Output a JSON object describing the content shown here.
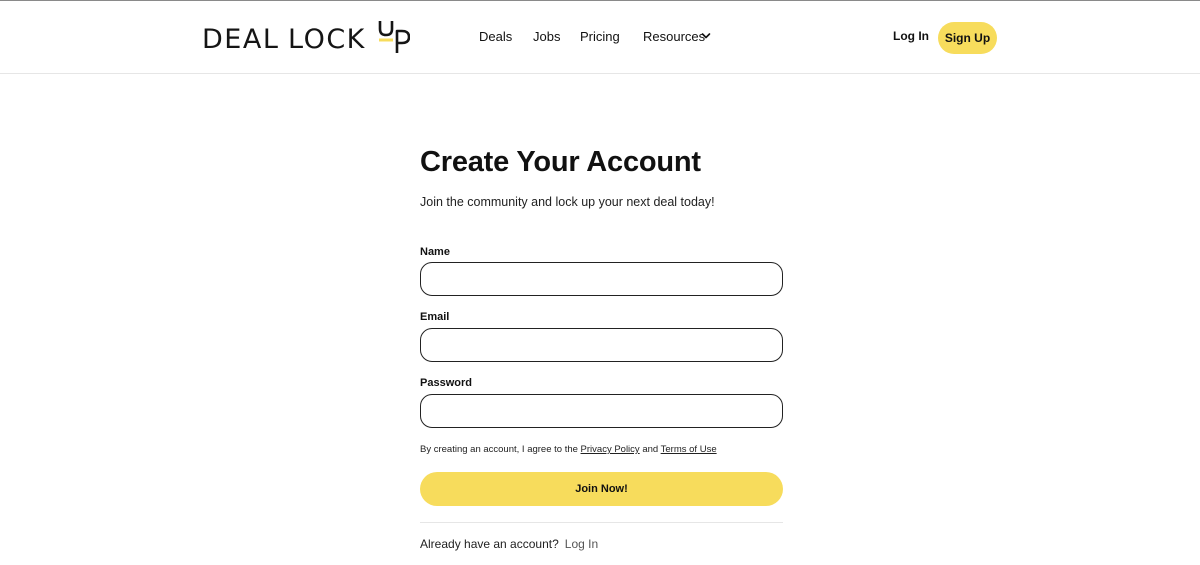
{
  "header": {
    "logo": {
      "word1": "DEAL",
      "word2": "LOCK",
      "word3": "UP"
    },
    "nav": [
      {
        "label": "Deals"
      },
      {
        "label": "Jobs"
      },
      {
        "label": "Pricing"
      },
      {
        "label": "Resources",
        "icon": "chevron-down-icon"
      }
    ],
    "login_label": "Log In",
    "signup_label": "Sign Up"
  },
  "form": {
    "title": "Create Your Account",
    "subtitle": "Join the community and lock up your next deal today!",
    "fields": {
      "name": {
        "label": "Name",
        "value": "",
        "placeholder": ""
      },
      "email": {
        "label": "Email",
        "value": "",
        "placeholder": ""
      },
      "password": {
        "label": "Password",
        "value": "",
        "placeholder": ""
      }
    },
    "agreement": {
      "prefix": "By creating an account, I agree to the",
      "privacy_link": "Privacy Policy",
      "and": "and",
      "terms_link": "Terms of Use"
    },
    "submit_label": "Join Now!",
    "footer": {
      "question": "Already have an account?",
      "login_link": "Log In"
    }
  },
  "colors": {
    "accent_yellow": "#f7dc5c",
    "text": "#111111",
    "border": "#222222"
  }
}
